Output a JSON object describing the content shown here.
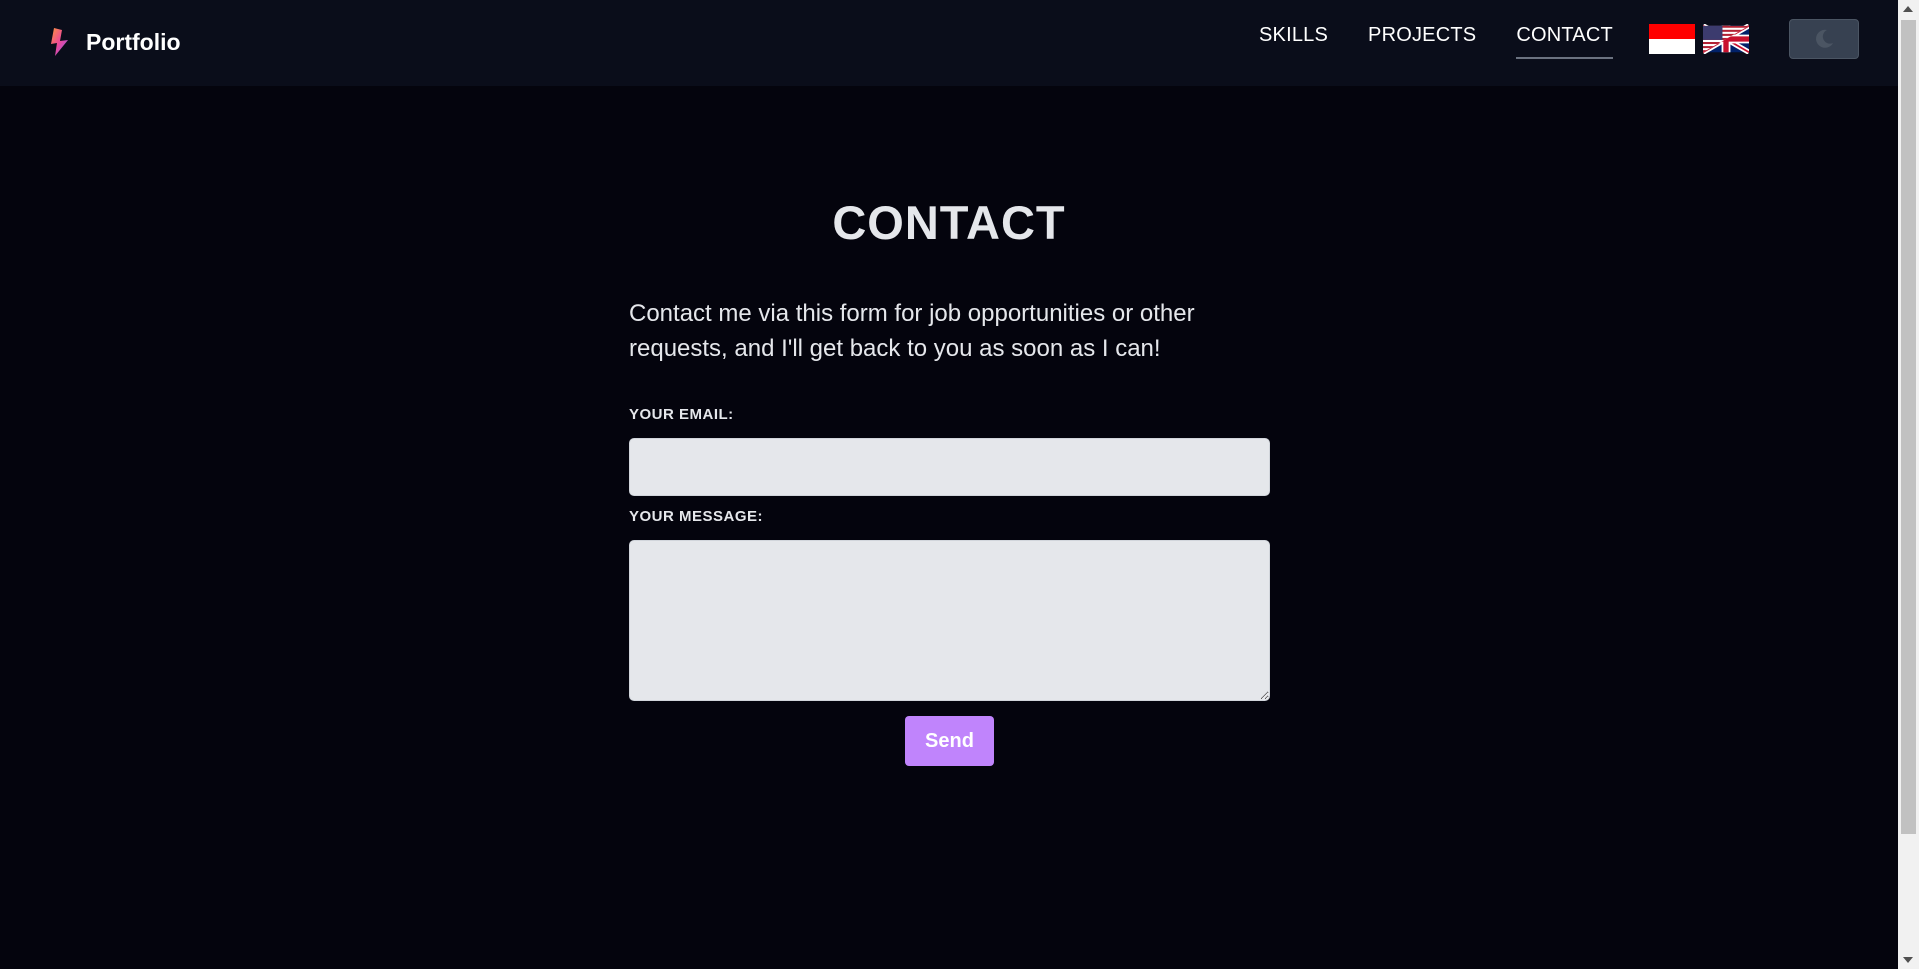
{
  "navbar": {
    "brand": "Portfolio",
    "links": [
      {
        "label": "SKILLS",
        "active": false
      },
      {
        "label": "PROJECTS",
        "active": false
      },
      {
        "label": "CONTACT",
        "active": true
      }
    ],
    "flags": [
      "indonesia-flag-icon",
      "us-uk-flag-icon"
    ],
    "theme_toggle_icon": "moon-icon"
  },
  "main": {
    "title": "CONTACT",
    "intro": "Contact me via this form for job opportunities or other requests, and I'll get back to you as soon as I can!",
    "email_label": "YOUR EMAIL:",
    "email_value": "",
    "message_label": "YOUR MESSAGE:",
    "message_value": "",
    "send_label": "Send"
  },
  "colors": {
    "background": "#04040d",
    "navbar": "#0a0d1a",
    "accent": "#c084fc",
    "input_bg": "#e5e7eb"
  }
}
